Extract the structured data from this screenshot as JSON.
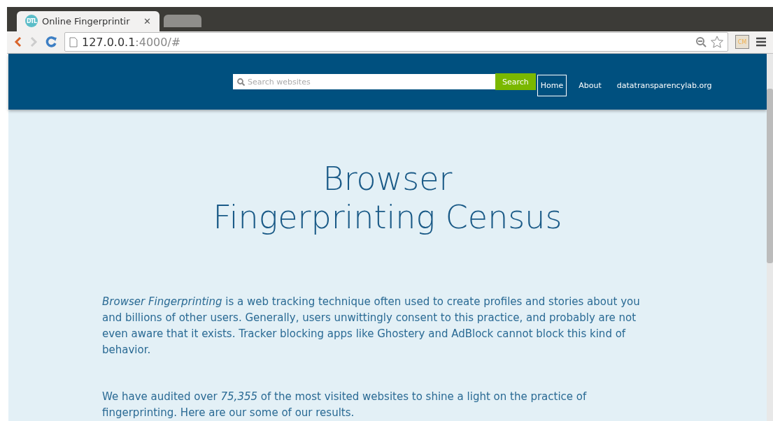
{
  "browser": {
    "tabs": [
      {
        "title": "Online Fingerprintir",
        "favicon": "DTL",
        "close": "✕",
        "selected": true
      },
      {
        "selected": false
      }
    ],
    "address": {
      "host": "127.0.0.1",
      "rest": ":4000/#"
    },
    "extension": "CM"
  },
  "header": {
    "search": {
      "placeholder": "Search websites",
      "button": "Search"
    },
    "nav": [
      {
        "label": "Home",
        "selected": true
      },
      {
        "label": "About",
        "selected": false
      },
      {
        "label": "datatransparencylab.org",
        "selected": false
      }
    ]
  },
  "hero": {
    "title_lines": [
      "Browser",
      "Fingerprinting Census"
    ]
  },
  "paragraphs": [
    "*Browser Fingerprinting* is a web tracking technique often used to create profiles and stories about you and billions of other users. Generally, users unwittingly consent to this practice, and probably are not even aware that it exists. Tracker blocking apps like Ghostery and AdBlock cannot block this kind of behavior.",
    "We have audited over *75,355* of the most visited websites to shine a light on the practice of fingerprinting. Here are our some of our results."
  ]
}
